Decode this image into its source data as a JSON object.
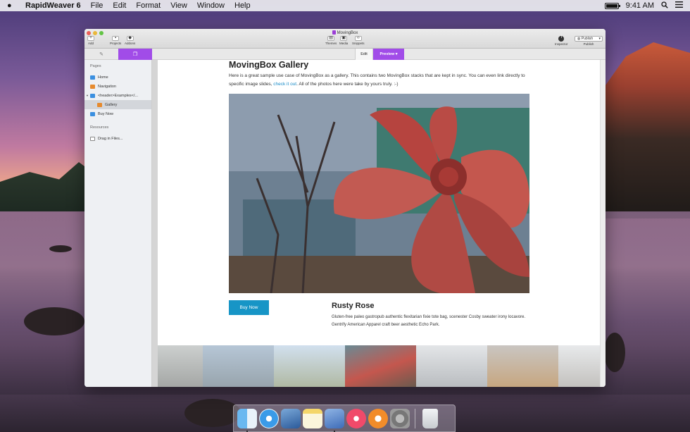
{
  "menubar": {
    "app_name": "RapidWeaver 6",
    "items": [
      "File",
      "Edit",
      "Format",
      "View",
      "Window",
      "Help"
    ],
    "clock": "9:41 AM",
    "battery_level": 1.0
  },
  "window": {
    "title": "MovingBox",
    "toolbar": {
      "add": "Add",
      "projects": "Projects",
      "addons": "Addons",
      "themes": "Themes",
      "media": "Media",
      "snippets": "Snippets",
      "inspector": "Inspector",
      "publish_menu": "Publish",
      "publish_label": "Publish"
    },
    "tabs": {
      "edit": "Edit",
      "preview": "Preview"
    },
    "sidebar": {
      "pages_header": "Pages",
      "pages": [
        {
          "label": "Home",
          "icon": "page-blue"
        },
        {
          "label": "Navigation",
          "icon": "page-orange"
        },
        {
          "label": "<header>Examples</...",
          "icon": "page-blue"
        },
        {
          "label": "Gallery",
          "icon": "page-orange"
        },
        {
          "label": "Buy Now",
          "icon": "page-blue"
        }
      ],
      "resources_header": "Resources",
      "resources": [
        {
          "label": "Drag in Files...",
          "icon": "file"
        }
      ]
    },
    "page": {
      "title": "MovingBox Gallery",
      "intro_before": "Here is a great sample use case of MovingBox as a gallery. This contains two MovingBox stacks that are kept in sync. You can even link directly to specific image slides, ",
      "intro_link": "check it out",
      "intro_after": ". All of the photos here were take by yours truly. :-)",
      "buy_label": "Buy Now",
      "slide_title": "Rusty Rose",
      "slide_text": "Gluten-free paleo gastropub authentic flexitarian fixie tote bag, scenester Cosby sweater irony locavore. Gentrify American Apparel craft beer aesthetic Echo Park."
    }
  },
  "colors": {
    "accent": "#a14ce8",
    "link": "#1a8cc8",
    "button": "#1795c6"
  }
}
